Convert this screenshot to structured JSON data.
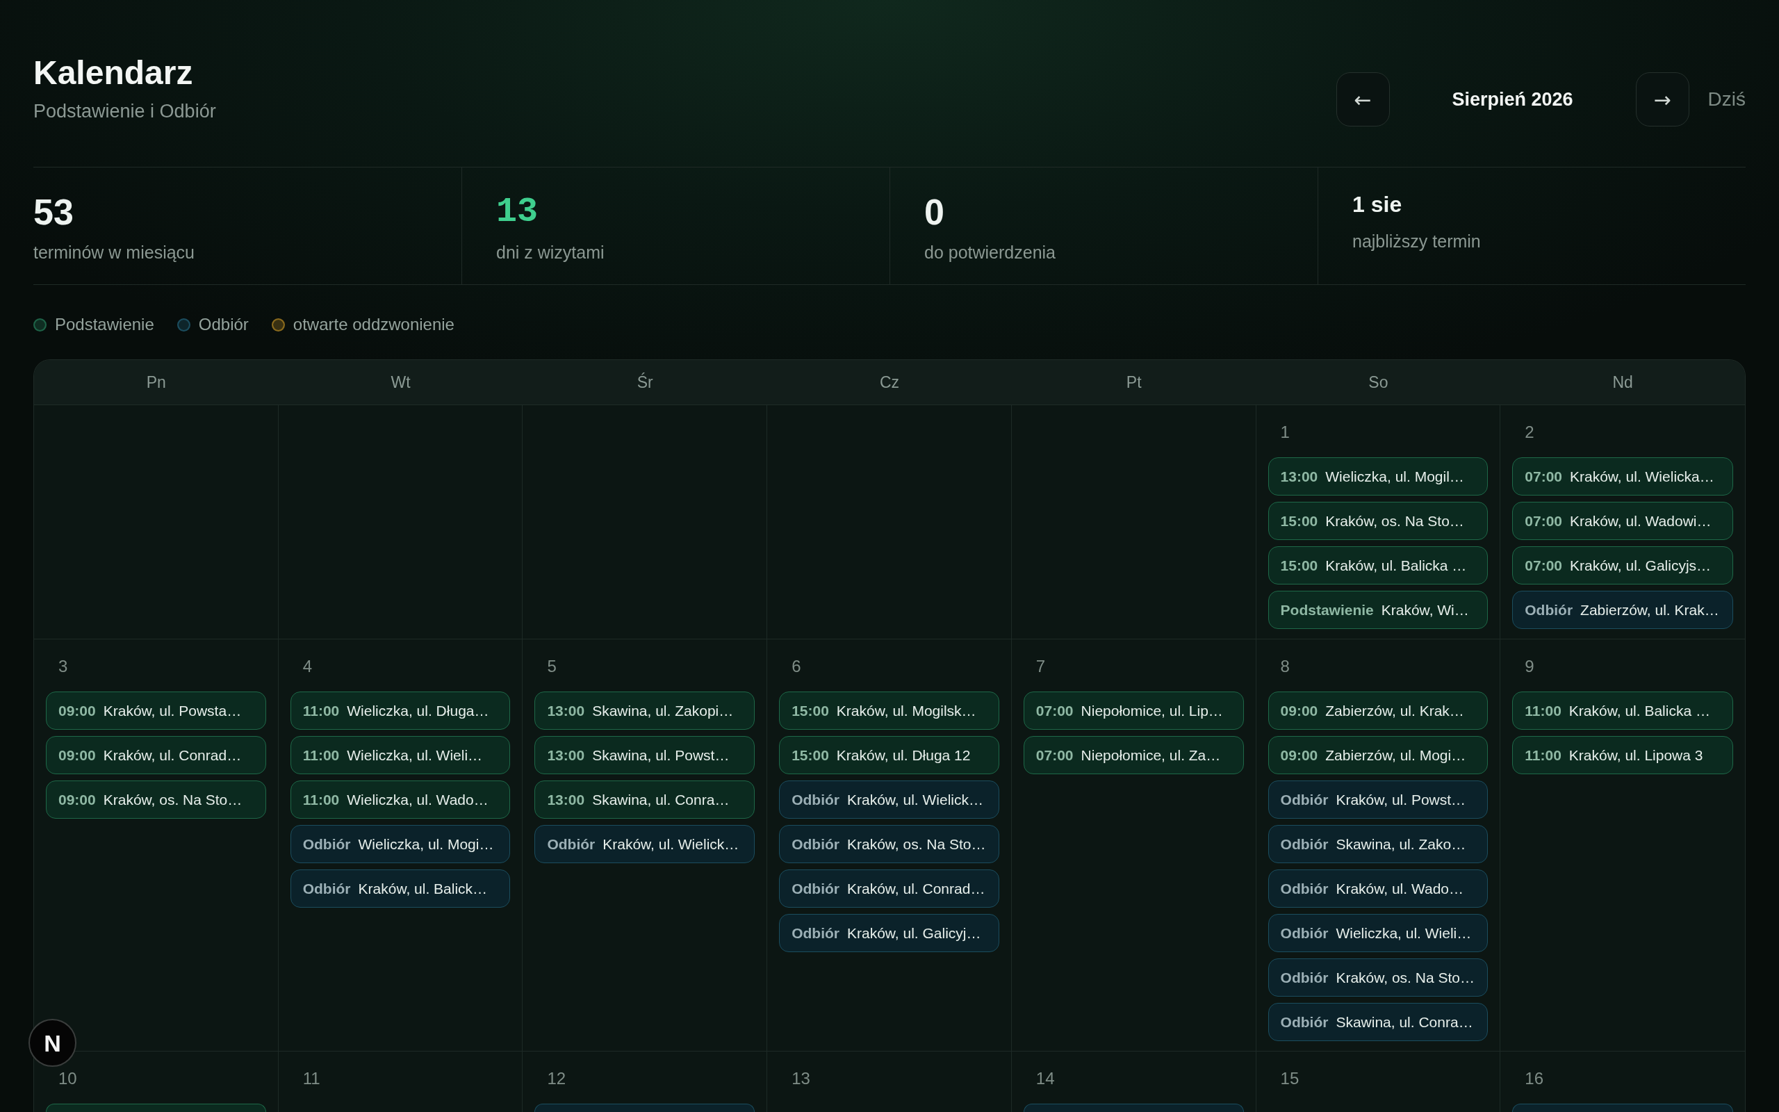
{
  "header": {
    "title": "Kalendarz",
    "subtitle": "Podstawienie i Odbiór"
  },
  "nav": {
    "prev": "←",
    "month": "Sierpień 2026",
    "next": "→",
    "today": "Dziś"
  },
  "stats": [
    {
      "kind": "count",
      "value": "53",
      "label": "terminów w miesiącu"
    },
    {
      "kind": "accent",
      "value": "13",
      "label": "dni z wizytami"
    },
    {
      "kind": "count",
      "value": "0",
      "label": "do potwierdzenia"
    },
    {
      "kind": "date",
      "value": "1 sie",
      "label": "najbliższy termin"
    }
  ],
  "legend": [
    {
      "label": "Podstawienie",
      "color": "#1e6247"
    },
    {
      "label": "Odbiór",
      "color": "#1b4d5e"
    },
    {
      "label": "otwarte oddzwonienie",
      "color": "#8a6a1d"
    }
  ],
  "calendar": {
    "weekdays": [
      "Pn",
      "Wt",
      "Śr",
      "Cz",
      "Pt",
      "So",
      "Nd"
    ],
    "weeks": [
      {
        "starts_mid_week": true,
        "days": [
          {
            "day": "1",
            "events": [
              {
                "kind": "podstawienie",
                "time": "13:00",
                "address": "Wieliczka, ul. Mogil…"
              },
              {
                "kind": "podstawienie",
                "time": "15:00",
                "address": "Kraków, os. Na Sto…"
              },
              {
                "kind": "podstawienie",
                "time": "15:00",
                "address": "Kraków, ul. Balicka …"
              },
              {
                "kind": "podstawienie",
                "label": "Podstawienie",
                "address": "Kraków, Wi…"
              }
            ]
          },
          {
            "day": "2",
            "events": [
              {
                "kind": "podstawienie",
                "time": "07:00",
                "address": "Kraków, ul. Wielicka…"
              },
              {
                "kind": "podstawienie",
                "time": "07:00",
                "address": "Kraków, ul. Wadowi…"
              },
              {
                "kind": "podstawienie",
                "time": "07:00",
                "address": "Kraków, ul. Galicyjs…"
              },
              {
                "kind": "odbior",
                "label": "Odbiór",
                "address": "Zabierzów, ul. Krak…"
              }
            ]
          }
        ]
      },
      {
        "days": [
          {
            "day": "3",
            "events": [
              {
                "kind": "podstawienie",
                "time": "09:00",
                "address": "Kraków, ul. Powsta…"
              },
              {
                "kind": "podstawienie",
                "time": "09:00",
                "address": "Kraków, ul. Conrad…"
              },
              {
                "kind": "podstawienie",
                "time": "09:00",
                "address": "Kraków, os. Na Sto…"
              }
            ]
          },
          {
            "day": "4",
            "events": [
              {
                "kind": "podstawienie",
                "time": "11:00",
                "address": "Wieliczka, ul. Długa…"
              },
              {
                "kind": "podstawienie",
                "time": "11:00",
                "address": "Wieliczka, ul. Wieli…"
              },
              {
                "kind": "podstawienie",
                "time": "11:00",
                "address": "Wieliczka, ul. Wado…"
              },
              {
                "kind": "odbior",
                "label": "Odbiór",
                "address": "Wieliczka, ul. Mogi…"
              },
              {
                "kind": "odbior",
                "label": "Odbiór",
                "address": "Kraków, ul. Balick…"
              }
            ]
          },
          {
            "day": "5",
            "events": [
              {
                "kind": "podstawienie",
                "time": "13:00",
                "address": "Skawina, ul. Zakopi…"
              },
              {
                "kind": "podstawienie",
                "time": "13:00",
                "address": "Skawina, ul. Powst…"
              },
              {
                "kind": "podstawienie",
                "time": "13:00",
                "address": "Skawina, ul. Conra…"
              },
              {
                "kind": "odbior",
                "label": "Odbiór",
                "address": "Kraków, ul. Wielick…"
              }
            ]
          },
          {
            "day": "6",
            "events": [
              {
                "kind": "podstawienie",
                "time": "15:00",
                "address": "Kraków, ul. Mogilsk…"
              },
              {
                "kind": "podstawienie",
                "time": "15:00",
                "address": "Kraków, ul. Długa 12"
              },
              {
                "kind": "odbior",
                "label": "Odbiór",
                "address": "Kraków, ul. Wielick…"
              },
              {
                "kind": "odbior",
                "label": "Odbiór",
                "address": "Kraków, os. Na Sto…"
              },
              {
                "kind": "odbior",
                "label": "Odbiór",
                "address": "Kraków, ul. Conrad…"
              },
              {
                "kind": "odbior",
                "label": "Odbiór",
                "address": "Kraków, ul. Galicyj…"
              }
            ]
          },
          {
            "day": "7",
            "events": [
              {
                "kind": "podstawienie",
                "time": "07:00",
                "address": "Niepołomice, ul. Lip…"
              },
              {
                "kind": "podstawienie",
                "time": "07:00",
                "address": "Niepołomice, ul. Za…"
              }
            ]
          },
          {
            "day": "8",
            "events": [
              {
                "kind": "podstawienie",
                "time": "09:00",
                "address": "Zabierzów, ul. Krak…"
              },
              {
                "kind": "podstawienie",
                "time": "09:00",
                "address": "Zabierzów, ul. Mogi…"
              },
              {
                "kind": "odbior",
                "label": "Odbiór",
                "address": "Kraków, ul. Powst…"
              },
              {
                "kind": "odbior",
                "label": "Odbiór",
                "address": "Skawina, ul. Zako…"
              },
              {
                "kind": "odbior",
                "label": "Odbiór",
                "address": "Kraków, ul. Wado…"
              },
              {
                "kind": "odbior",
                "label": "Odbiór",
                "address": "Wieliczka, ul. Wieli…"
              },
              {
                "kind": "odbior",
                "label": "Odbiór",
                "address": "Kraków, os. Na Sto…"
              },
              {
                "kind": "odbior",
                "label": "Odbiór",
                "address": "Skawina, ul. Conra…"
              }
            ]
          },
          {
            "day": "9",
            "events": [
              {
                "kind": "podstawienie",
                "time": "11:00",
                "address": "Kraków, ul. Balicka …"
              },
              {
                "kind": "podstawienie",
                "time": "11:00",
                "address": "Kraków, ul. Lipowa 3"
              }
            ]
          }
        ]
      },
      {
        "days": [
          {
            "day": "10",
            "events": [
              {
                "kind": "podstawienie"
              }
            ]
          },
          {
            "day": "11"
          },
          {
            "day": "12",
            "events": [
              {
                "kind": "odbior"
              }
            ]
          },
          {
            "day": "13"
          },
          {
            "day": "14",
            "events": [
              {
                "kind": "odbior"
              }
            ]
          },
          {
            "day": "15"
          },
          {
            "day": "16",
            "events": [
              {
                "kind": "odbior"
              }
            ]
          }
        ]
      }
    ]
  },
  "dev_badge": {
    "label": "N"
  }
}
